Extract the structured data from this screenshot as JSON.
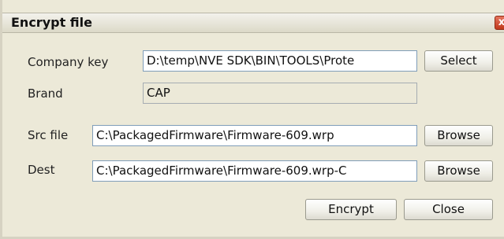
{
  "window": {
    "title": "Encrypt file",
    "close_glyph": "x"
  },
  "form": {
    "company_key": {
      "label": "Company key",
      "value": "D:\\temp\\NVE SDK\\BIN\\TOOLS\\Prote",
      "button": "Select"
    },
    "brand": {
      "label": "Brand",
      "value": "CAP"
    },
    "src_file": {
      "label": "Src file",
      "value": "C:\\PackagedFirmware\\Firmware-609.wrp",
      "button": "Browse"
    },
    "dest": {
      "label": "Dest",
      "value": "C:\\PackagedFirmware\\Firmware-609.wrp-C",
      "button": "Browse"
    }
  },
  "actions": {
    "encrypt": "Encrypt",
    "close": "Close"
  }
}
